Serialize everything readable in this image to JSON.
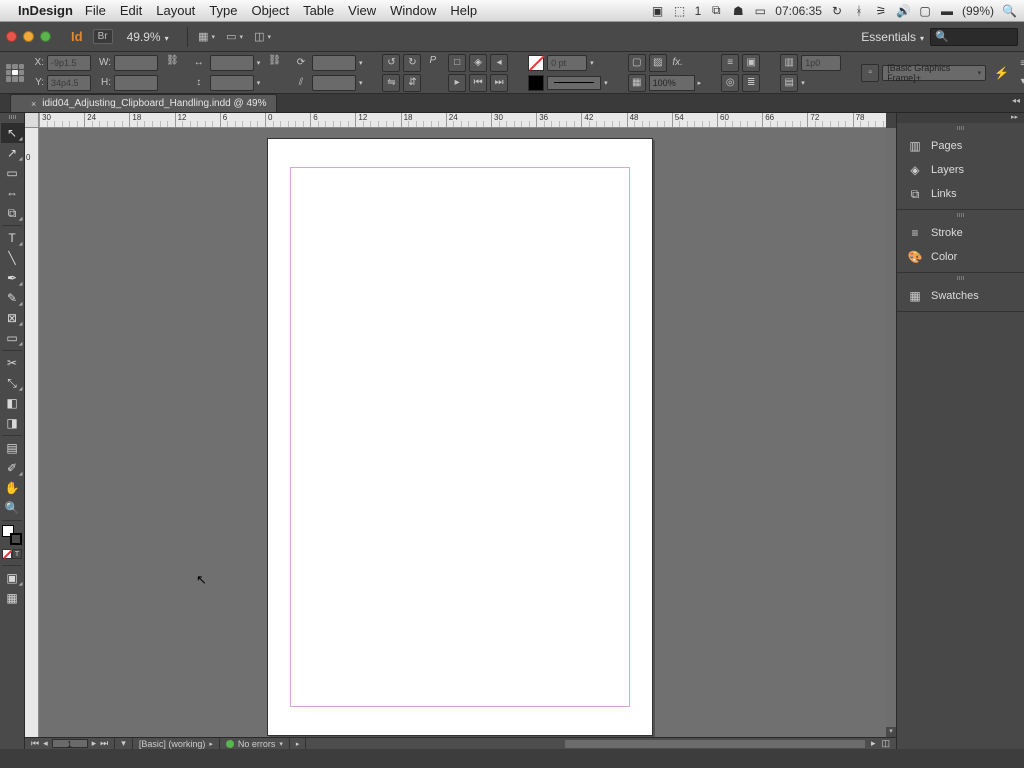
{
  "mac_menu": {
    "app_name": "InDesign",
    "items": [
      "File",
      "Edit",
      "Layout",
      "Type",
      "Object",
      "Table",
      "View",
      "Window",
      "Help"
    ],
    "status": {
      "adobe_badge": "1",
      "time": "07:06:35",
      "battery": "(99%)"
    }
  },
  "app_bar": {
    "id_label": "Id",
    "br_label": "Br",
    "zoom": "49.9%",
    "workspace": "Essentials",
    "search_placeholder": ""
  },
  "control_panel": {
    "x": "-9p1.5",
    "y": "34p4.5",
    "w": "",
    "h": "",
    "scale_x": "",
    "scale_y": "",
    "rotate": "",
    "shear": "",
    "stroke_weight": "0 pt",
    "opacity": "100%",
    "col_gutter": "1p0",
    "object_style": "[Basic Graphics Frame]+"
  },
  "document": {
    "tab_title": "idid04_Adjusting_Clipboard_Handling.indd @ 49%"
  },
  "ruler": {
    "ticks": [
      "30",
      "24",
      "18",
      "12",
      "6",
      "0",
      "6",
      "12",
      "18",
      "24",
      "30",
      "36",
      "42",
      "48",
      "54",
      "60",
      "66",
      "72",
      "78"
    ]
  },
  "v_origin_label": "0",
  "panels": {
    "group1": [
      {
        "icon": "pages",
        "label": "Pages"
      },
      {
        "icon": "layers",
        "label": "Layers"
      },
      {
        "icon": "links",
        "label": "Links"
      }
    ],
    "group2": [
      {
        "icon": "stroke",
        "label": "Stroke"
      },
      {
        "icon": "color",
        "label": "Color"
      }
    ],
    "group3": [
      {
        "icon": "swatches",
        "label": "Swatches"
      }
    ]
  },
  "statusbar": {
    "page": "1",
    "profile": "[Basic] (working)",
    "preflight": "No errors"
  }
}
